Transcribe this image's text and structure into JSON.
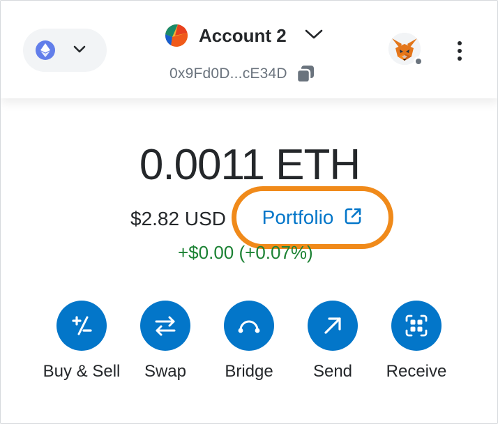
{
  "header": {
    "network": {
      "icon": "ethereum-icon",
      "accent": "#627eea"
    },
    "account": {
      "name": "Account 2",
      "address": "0x9Fd0D...cE34D"
    },
    "status_color": "#6a737d"
  },
  "wallet": {
    "balance": "0.0011 ETH",
    "fiat": "$2.82 USD",
    "portfolio_label": "Portfolio",
    "change": "+$0.00 (+0.07%)",
    "highlight_color": "#f08a1a",
    "link_color": "#0376c9",
    "positive_color": "#1c8234"
  },
  "actions": [
    {
      "label": "Buy & Sell",
      "icon": "buy-sell-icon"
    },
    {
      "label": "Swap",
      "icon": "swap-icon"
    },
    {
      "label": "Bridge",
      "icon": "bridge-icon"
    },
    {
      "label": "Send",
      "icon": "send-icon"
    },
    {
      "label": "Receive",
      "icon": "receive-icon"
    }
  ]
}
